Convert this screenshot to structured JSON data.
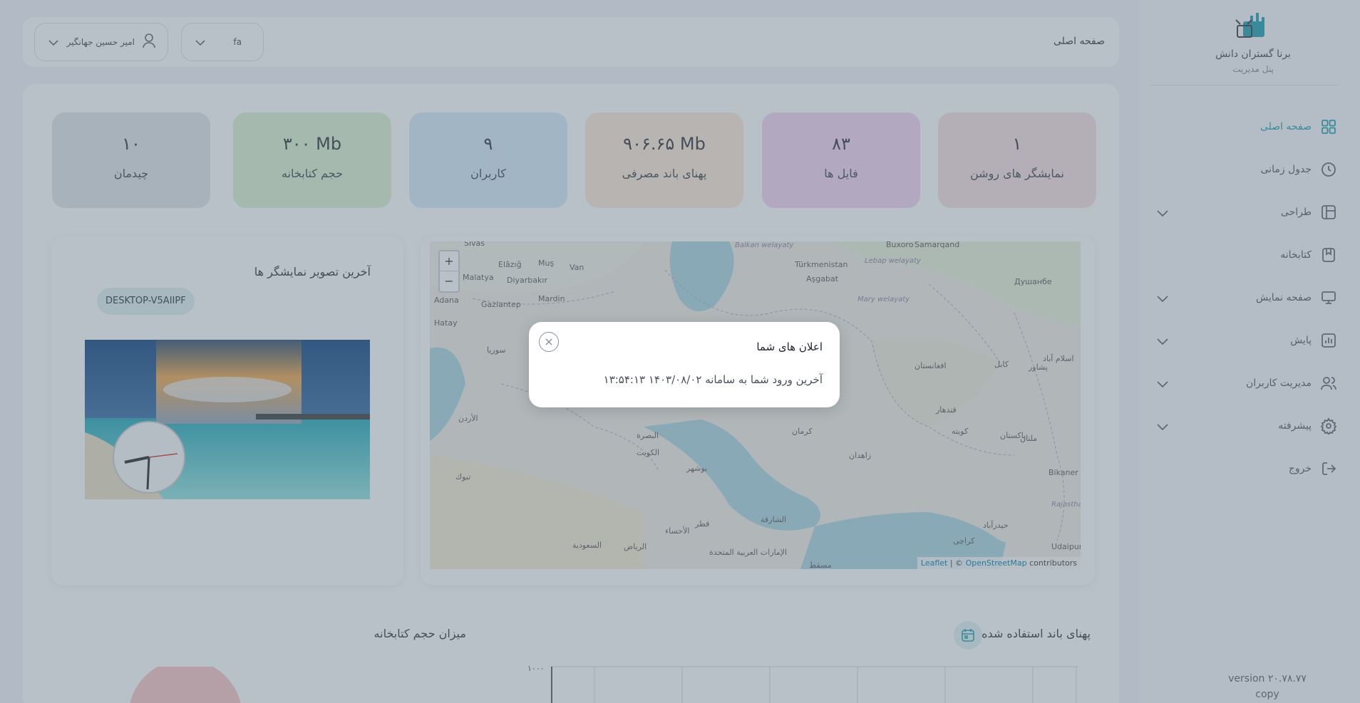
{
  "brand": {
    "title": "برنا گستران دانش",
    "subtitle": "پنل مدیریت",
    "logo_icon": "tv-logo-icon"
  },
  "sidebar": {
    "items": [
      {
        "label": "صفحه اصلی",
        "icon": "grid-icon",
        "active": true,
        "expandable": false
      },
      {
        "label": "جدول زمانی",
        "icon": "clock-icon",
        "active": false,
        "expandable": false
      },
      {
        "label": "طراحی",
        "icon": "layout-icon",
        "active": false,
        "expandable": true
      },
      {
        "label": "کتابخانه",
        "icon": "bookmark-icon",
        "active": false,
        "expandable": false
      },
      {
        "label": "صفحه نمایش",
        "icon": "monitor-icon",
        "active": false,
        "expandable": true
      },
      {
        "label": "پایش",
        "icon": "chart-icon",
        "active": false,
        "expandable": true
      },
      {
        "label": "مدیریت کاربران",
        "icon": "users-icon",
        "active": false,
        "expandable": true
      },
      {
        "label": "پیشرفته",
        "icon": "gear-icon",
        "active": false,
        "expandable": true
      },
      {
        "label": "خروج",
        "icon": "logout-icon",
        "active": false,
        "expandable": false
      }
    ],
    "version": "version ۲۰.۷۸.۷۷",
    "copy": "copy"
  },
  "header": {
    "breadcrumb": "صفحه اصلی",
    "user_name": "امیر حسین جهانگیر",
    "lang": "fa"
  },
  "stats": [
    {
      "value": "۱",
      "label": "نمایشگر های روشن",
      "color": "#f6dede"
    },
    {
      "value": "۸۳",
      "label": "فایل ها",
      "color": "#f2d2ef"
    },
    {
      "value": "۹۰۶.۶۵ Mb",
      "label": "پهنای باند مصرفی",
      "color": "#fbe8d6"
    },
    {
      "value": "۹",
      "label": "کاربران",
      "color": "#d6e9f8"
    },
    {
      "value": "۳۰۰ Mb",
      "label": "حجم کتابخانه",
      "color": "#dbf1cf"
    },
    {
      "value": "۱۰",
      "label": "چیدمان",
      "color": "#e1e3e8"
    }
  ],
  "screens_panel": {
    "title": "آخرین تصویر نمایشگر ها",
    "device": "DESKTOP-V5AIIPF"
  },
  "map": {
    "zoom_in": "+",
    "zoom_out": "−",
    "attribution_leaflet": "Leaflet",
    "attribution_sep": "| ©",
    "attribution_osm": "OpenStreetMap",
    "attribution_tail": "contributors",
    "labels": [
      "Türkmenistan",
      "Aşgabat",
      "Samarqand",
      "Buxoro",
      "Душанбе",
      "Malatya",
      "Elâzığ",
      "Muş",
      "Van",
      "Diyarbakır",
      "Mardin",
      "Gaziantep",
      "Adana",
      "Hatay",
      "Sivas",
      "Balkan welayaty",
      "Lebap welayaty",
      "Mary welayaty",
      "سوريا",
      "الأردن",
      "الكويت",
      "البصرة",
      "الرياض",
      "قطر",
      "بوشهر",
      "کرمان",
      "زاهدان",
      "افغانستان",
      "کابل",
      "پاکستان",
      "کراچی",
      "حيدرآباد",
      "Bikaner",
      "Udaipur",
      "Rajasthan",
      "مسقط",
      "الإمارات العربية المتحدة",
      "الشارقة",
      "کویته",
      "قندهار",
      "ملتان",
      "پشاور",
      "اسلام آباد",
      "تبوك",
      "الأحساء",
      "السعودية"
    ]
  },
  "bandwidth_panel": {
    "title": "پهنای باند استفاده شده",
    "y_tick": "۱۰۰۰"
  },
  "library_panel": {
    "title": "میزان حجم کتابخانه"
  },
  "modal": {
    "title": "اعلان های شما",
    "body": "آخرین ورود شما به سامانه ۱۴۰۳/۰۸/۰۲ ۱۳:۵۴:۱۳"
  }
}
